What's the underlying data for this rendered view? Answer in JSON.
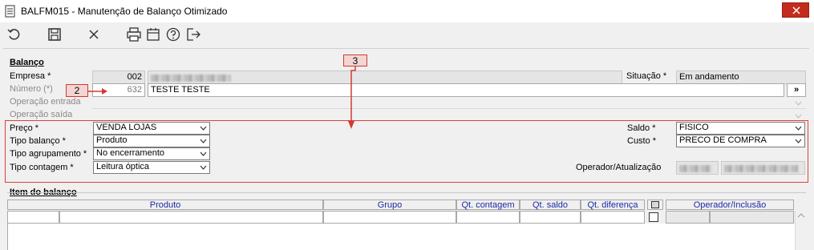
{
  "window": {
    "title": "BALFM015 - Manutenção de Balanço Otimizado",
    "close_label": "✕"
  },
  "toolbar": {
    "icons": [
      "undo-icon",
      "save-icon",
      "cancel-icon",
      "print-icon",
      "calendar-icon",
      "help-icon",
      "exit-icon"
    ]
  },
  "balanco": {
    "section_title": "Balanço",
    "empresa_label": "Empresa *",
    "empresa_code": "002",
    "numero_label": "Número (*)",
    "numero_value": "632",
    "numero_description": "TESTE TESTE",
    "nav_button": "»",
    "operacao_entrada_label": "Operação entrada",
    "operacao_saida_label": "Operação saída",
    "situacao_label": "Situação *",
    "situacao_value": "Em andamento",
    "preco_label": "Preço *",
    "preco_value": "VENDA LOJAS",
    "tipo_balanco_label": "Tipo balanço *",
    "tipo_balanco_value": "Produto",
    "tipo_agrupamento_label": "Tipo agrupamento *",
    "tipo_agrupamento_value": "No encerramento",
    "tipo_contagem_label": "Tipo contagem *",
    "tipo_contagem_value": "Leitura óptica",
    "saldo_label": "Saldo *",
    "saldo_value": "FISICO",
    "custo_label": "Custo *",
    "custo_value": "PRECO DE COMPRA",
    "operador_label": "Operador/Atualização"
  },
  "annotations": {
    "marker_2": "2",
    "marker_3": "3"
  },
  "itens": {
    "section_title": "Item do balanço",
    "columns": [
      "Produto",
      "Grupo",
      "Qt. contagem",
      "Qt. saldo",
      "Qt. diferença",
      "Operador/Inclusão"
    ]
  },
  "colors": {
    "annotation_red": "#d33a33",
    "header_blue": "#1a2aa8",
    "close_red": "#c42b1c"
  }
}
